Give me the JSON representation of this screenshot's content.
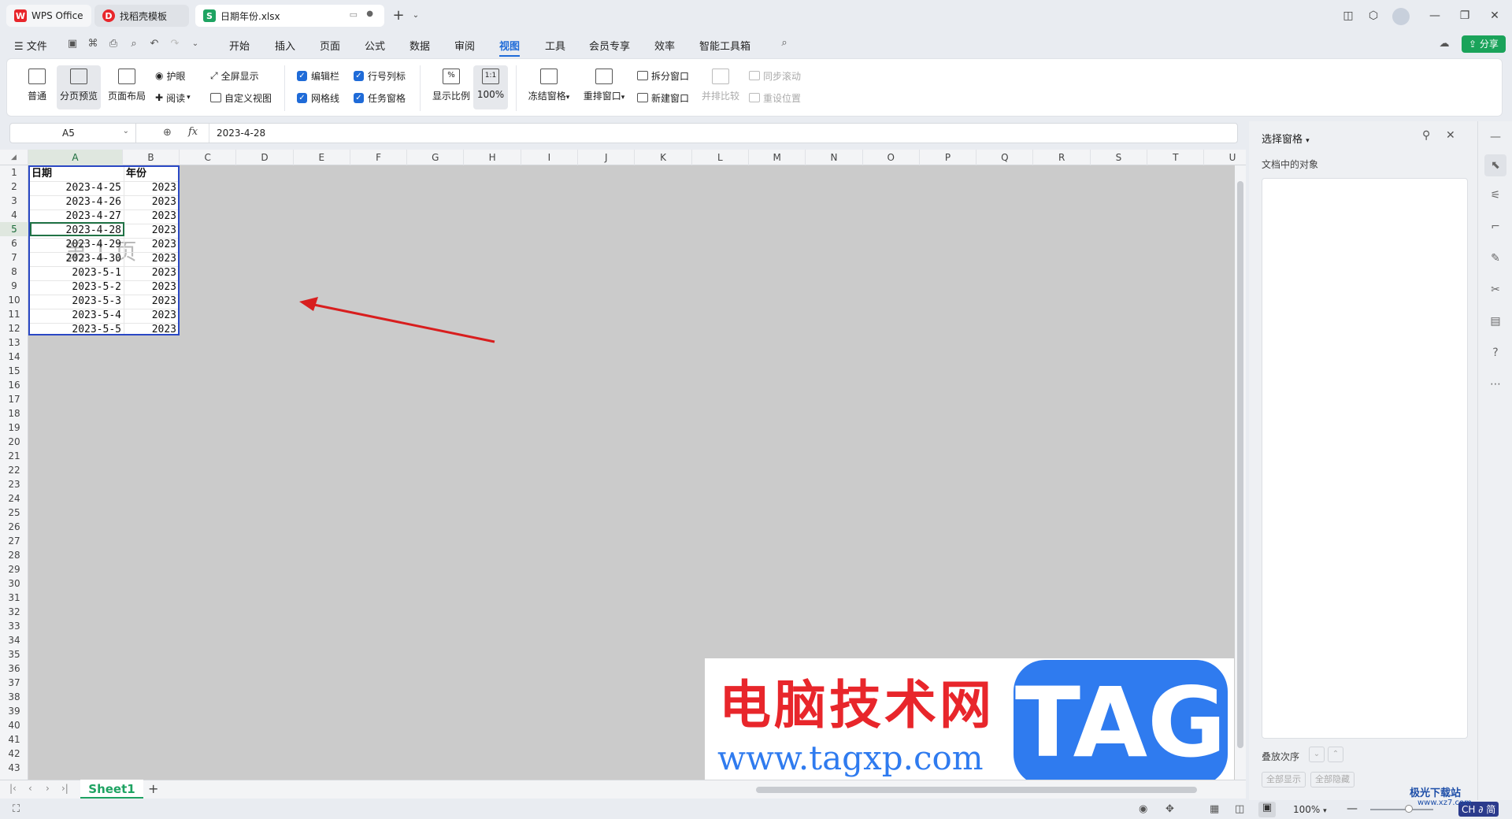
{
  "tabs": [
    {
      "label": "WPS Office"
    },
    {
      "label": "找稻壳模板"
    },
    {
      "label": "日期年份.xlsx"
    }
  ],
  "menu": {
    "file": "文件",
    "items": [
      "开始",
      "插入",
      "页面",
      "公式",
      "数据",
      "审阅",
      "视图",
      "工具",
      "会员专享",
      "效率",
      "智能工具箱"
    ],
    "active": "视图",
    "share": "分享"
  },
  "ribbon": {
    "normal": "普通",
    "page_break_preview": "分页预览",
    "page_layout": "页面布局",
    "eye_protect": "护眼",
    "reading": "阅读",
    "fullscreen": "全屏显示",
    "custom_view": "自定义视图",
    "edit_bar": "编辑栏",
    "row_col_headers": "行号列标",
    "gridlines": "网格线",
    "task_pane": "任务窗格",
    "zoom": "显示比例",
    "zoom_100": "100%",
    "freeze": "冻结窗格",
    "rearrange": "重排窗口",
    "split": "拆分窗口",
    "new_window": "新建窗口",
    "side_by_side": "并排比较",
    "sync_scroll": "同步滚动",
    "reset_position": "重设位置"
  },
  "formula_bar": {
    "cell_ref": "A5",
    "fx": "fx",
    "value": "2023-4-28"
  },
  "columns": [
    "A",
    "B",
    "C",
    "D",
    "E",
    "F",
    "G",
    "H",
    "I",
    "J",
    "K",
    "L",
    "M",
    "N",
    "O",
    "P",
    "Q",
    "R",
    "S",
    "T",
    "U"
  ],
  "rows": [
    "1",
    "2",
    "3",
    "4",
    "5",
    "6",
    "7",
    "8",
    "9",
    "10",
    "11",
    "12",
    "13",
    "14",
    "15",
    "16",
    "17",
    "18",
    "19",
    "20",
    "21",
    "22",
    "23",
    "24",
    "25",
    "26",
    "27",
    "28",
    "29",
    "30",
    "31",
    "32",
    "33",
    "34",
    "35",
    "36",
    "37",
    "38",
    "39",
    "40",
    "41",
    "42",
    "43"
  ],
  "table": {
    "header": [
      "日期",
      "年份"
    ],
    "data": [
      [
        "2023-4-25",
        "2023"
      ],
      [
        "2023-4-26",
        "2023"
      ],
      [
        "2023-4-27",
        "2023"
      ],
      [
        "2023-4-28",
        "2023"
      ],
      [
        "2023-4-29",
        "2023"
      ],
      [
        "2023-4-30",
        "2023"
      ],
      [
        "2023-5-1",
        "2023"
      ],
      [
        "2023-5-2",
        "2023"
      ],
      [
        "2023-5-3",
        "2023"
      ],
      [
        "2023-5-4",
        "2023"
      ],
      [
        "2023-5-5",
        "2023"
      ]
    ],
    "page_watermark": "第 1 页"
  },
  "right_panel": {
    "title": "选择窗格",
    "section": "文档中的对象",
    "stack_order": "叠放次序",
    "show_all": "全部显示",
    "hide_all": "全部隐藏"
  },
  "sheet": {
    "name": "Sheet1"
  },
  "status": {
    "zoom": "100%",
    "ime": "CH ∂ 简"
  },
  "watermark": {
    "title": "电脑技术网",
    "url": "www.tagxp.com",
    "tag": "TAG",
    "brand": "极光下载站",
    "brand_url": "www.xz7.com"
  },
  "colors": {
    "accent": "#1f6bd8",
    "selection": "#2a48c4",
    "active_cell": "#217346",
    "share": "#1aa35a",
    "wm_red": "#e8262b",
    "wm_blue": "#2f7bef",
    "arrow": "#d81e1e"
  }
}
